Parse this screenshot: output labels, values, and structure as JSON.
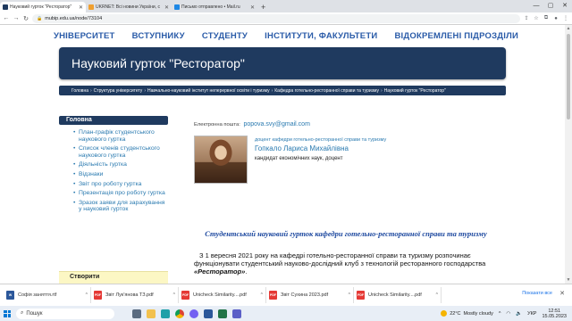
{
  "browser": {
    "tabs": [
      {
        "title": "Науковий гурток \"Ресторатор\"",
        "active": true,
        "fav_color": "#1f3a5f"
      },
      {
        "title": "UKRNET: Всі новини України, с",
        "active": false,
        "fav_color": "#f0a030"
      },
      {
        "title": "Письмо отправлено • Mail.ru",
        "active": false,
        "fav_color": "#1e88e5"
      }
    ],
    "new_tab": "+",
    "window_controls": {
      "minimize": "—",
      "maximize": "▢",
      "close": "✕"
    },
    "url": "mubip.edu.ua/node/73104"
  },
  "site": {
    "topnav": [
      "УНІВЕРСИТЕТ",
      "ВСТУПНИКУ",
      "СТУДЕНТУ",
      "ІНСТИТУТИ, ФАКУЛЬТЕТИ",
      "ВІДОКРЕМЛЕНІ ПІДРОЗДІЛИ"
    ],
    "page_title": "Науковий гурток \"Ресторатор\"",
    "breadcrumbs": [
      "Головна",
      "Структура університету",
      "Навчально-науковий інститут неперервної освіти і туризму",
      "Кафедра готельно-ресторанної справи та туризму",
      "Науковий гурток \"Ресторатор\""
    ],
    "breadcrumb_sep": "›",
    "sidebar": {
      "heading": "Головна",
      "items": [
        "План-графік студентського наукового гуртка",
        "Список членів студентського наукового гуртка",
        "Діяльність гуртка",
        "Відзнаки",
        "Звіт про роботу гуртка",
        "Презентація про роботу гуртка",
        "Зразок заяви для зарахування у науковий гурток"
      ],
      "create_label": "Створити"
    },
    "content": {
      "email_label": "Електронна пошта:",
      "email": "popova.svy@gmail.com",
      "role": "доцент кафедри готельно-ресторанної справи та туризму",
      "name": "Гопкало Лариса Михайлівна",
      "degree": "кандидат економічних наук, доцент",
      "club_title": "Студентський науковий гурток кафедри готельно-ресторанної справи та туризму",
      "paragraph_start": "З 1 вересня 2021 року на кафедрі готельно-ресторанної справи та туризму розпочинає функціонувати студентський науково-дослідний  клуб з технологій ресторанного господарства ",
      "paragraph_em": "«Ресторатор»",
      "paragraph_end": "."
    }
  },
  "downloads": {
    "items": [
      {
        "name": "Софія заняття.rtf",
        "type": "doc"
      },
      {
        "name": "Звіт Лук'янова ТЗ.pdf",
        "type": "pdf"
      },
      {
        "name": "Unicheck Similarity....pdf",
        "type": "pdf"
      },
      {
        "name": "Звіт Сухина 2023.pdf",
        "type": "pdf"
      },
      {
        "name": "Unicheck Similarity....pdf",
        "type": "pdf"
      }
    ],
    "show_all": "Показати все",
    "close": "✕"
  },
  "taskbar": {
    "search_placeholder": "Пошук",
    "weather_temp": "22°C",
    "weather_text": "Mostly cloudy",
    "lang": "УКР",
    "time": "12:51",
    "date": "15.05.2023"
  }
}
